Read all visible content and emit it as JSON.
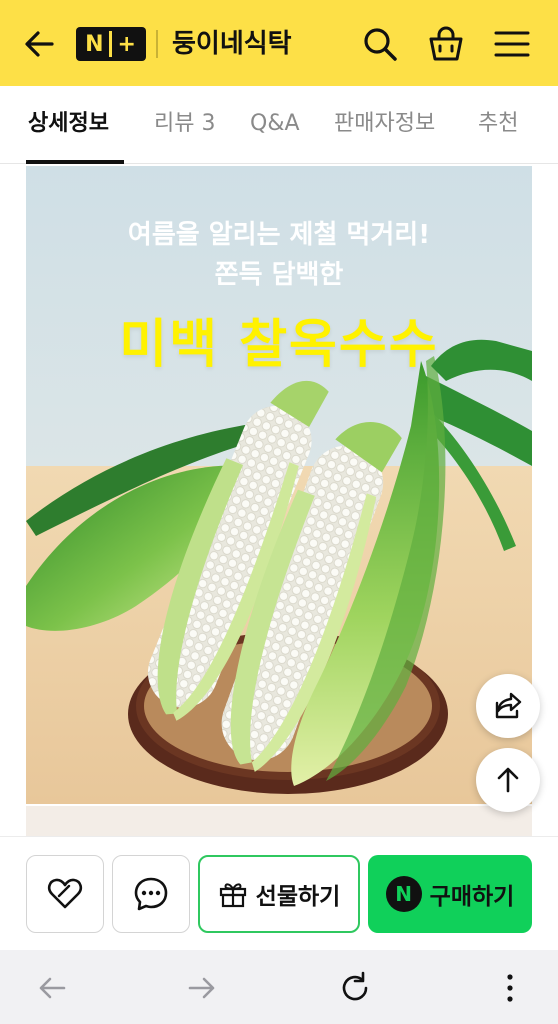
{
  "header": {
    "logo_text": "N+",
    "store_name": "둥이네식탁",
    "icons": [
      "back-arrow-icon",
      "search-icon",
      "shopping-bag-icon",
      "menu-icon"
    ],
    "background": "#fde047"
  },
  "tabs": [
    {
      "label": "상세정보",
      "active": true
    },
    {
      "label": "리뷰 3",
      "active": false
    },
    {
      "label": "Q&A",
      "active": false
    },
    {
      "label": "판매자정보",
      "active": false
    },
    {
      "label": "추천",
      "active": false
    }
  ],
  "product_image": {
    "headline_line1": "여름을 알리는 제철 먹거리!",
    "headline_line2": "쫀득 담백한",
    "headline_main": "미백 찰옥수수",
    "headline_main_color": "#fff200"
  },
  "floating_buttons": {
    "share_icon": "share-icon",
    "scroll_top_icon": "arrow-up-icon"
  },
  "action_bar": {
    "like_icon": "heart-icon",
    "chat_icon": "chat-bubble-icon",
    "gift_label": "선물하기",
    "buy_badge": "N",
    "buy_label": "구매하기",
    "buy_color": "#10d05a",
    "gift_border_color": "#2fc85f"
  },
  "browser_bar": {
    "icons": [
      "back-icon",
      "forward-icon",
      "reload-icon",
      "more-icon"
    ]
  }
}
